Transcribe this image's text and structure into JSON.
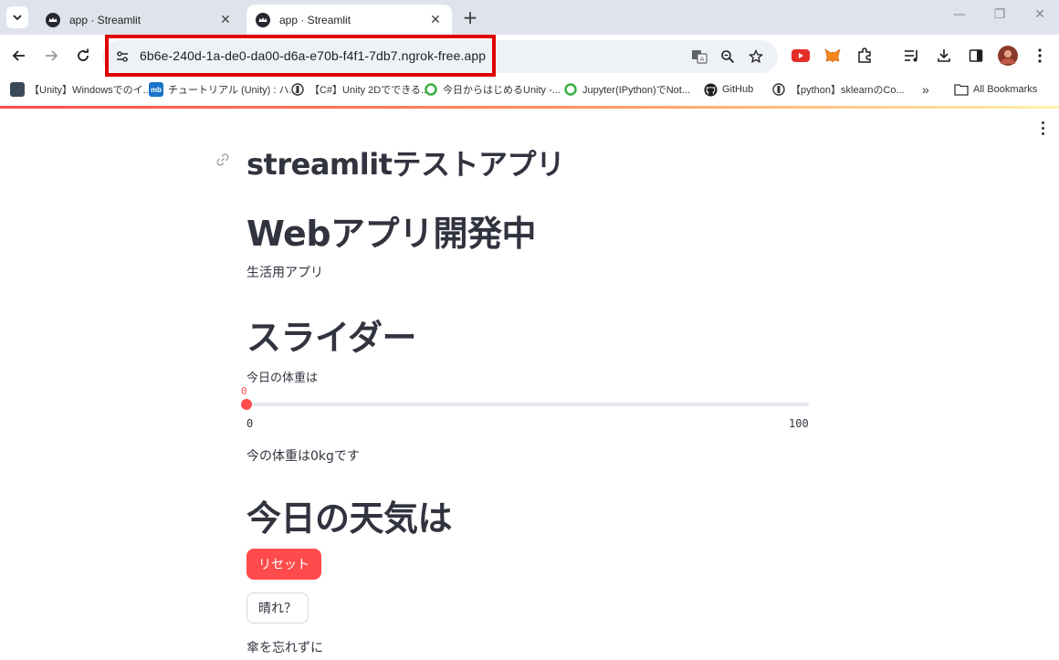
{
  "browser": {
    "tabs": [
      {
        "title": "app · Streamlit",
        "active": false
      },
      {
        "title": "app · Streamlit",
        "active": true
      }
    ],
    "url": "6b6e-240d-1a-de0-da00-d6a-e70b-f4f1-7db7.ngrok-free.app",
    "bookmarks": [
      {
        "label": "【Unity】Windowsでのイ..."
      },
      {
        "label": "チュートリアル (Unity) : ハ..."
      },
      {
        "label": "【C#】Unity 2Dでできる..."
      },
      {
        "label": "今日からはじめるUnity -..."
      },
      {
        "label": "Jupyter(IPython)でNot..."
      },
      {
        "label": "GitHub"
      },
      {
        "label": "【python】sklearnのCo..."
      }
    ],
    "all_bookmarks_label": "All Bookmarks",
    "overflow_label": "»"
  },
  "app": {
    "title": "streamlitテストアプリ",
    "header1": "Webアプリ開発中",
    "subtitle": "生活用アプリ",
    "header2": "スライダー",
    "slider": {
      "label": "今日の体重は",
      "value": 0,
      "value_text": "0",
      "min": "0",
      "max": "100",
      "min_value": 0,
      "max_value": 100
    },
    "weight_text": "今の体重は0kgです",
    "header3": "今日の天気は",
    "reset_button": "リセット",
    "sunny_button": "晴れ？",
    "umbrella_text": "傘を忘れずに"
  },
  "colors": {
    "accent": "#ff4b4b",
    "text": "#31333f",
    "highlight_box": "#e00000"
  }
}
